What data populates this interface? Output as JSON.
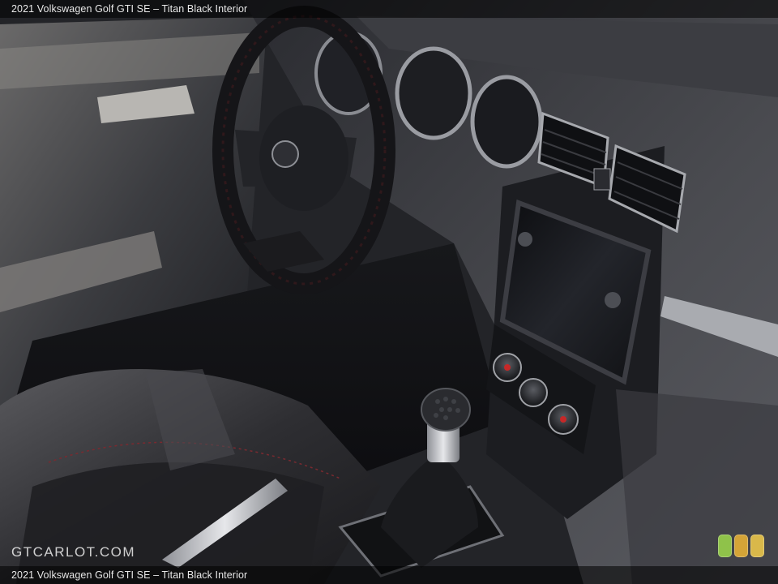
{
  "header": {
    "caption": "2021 Volkswagen Golf GTI SE – Titan Black Interior"
  },
  "footer": {
    "caption": "2021 Volkswagen Golf GTI SE – Titan Black Interior"
  },
  "watermark": {
    "text": "GTCARLOT.COM"
  },
  "badges": [
    {
      "color": "#8fc24a"
    },
    {
      "color": "#d4a437"
    },
    {
      "color": "#d9b84a"
    }
  ]
}
